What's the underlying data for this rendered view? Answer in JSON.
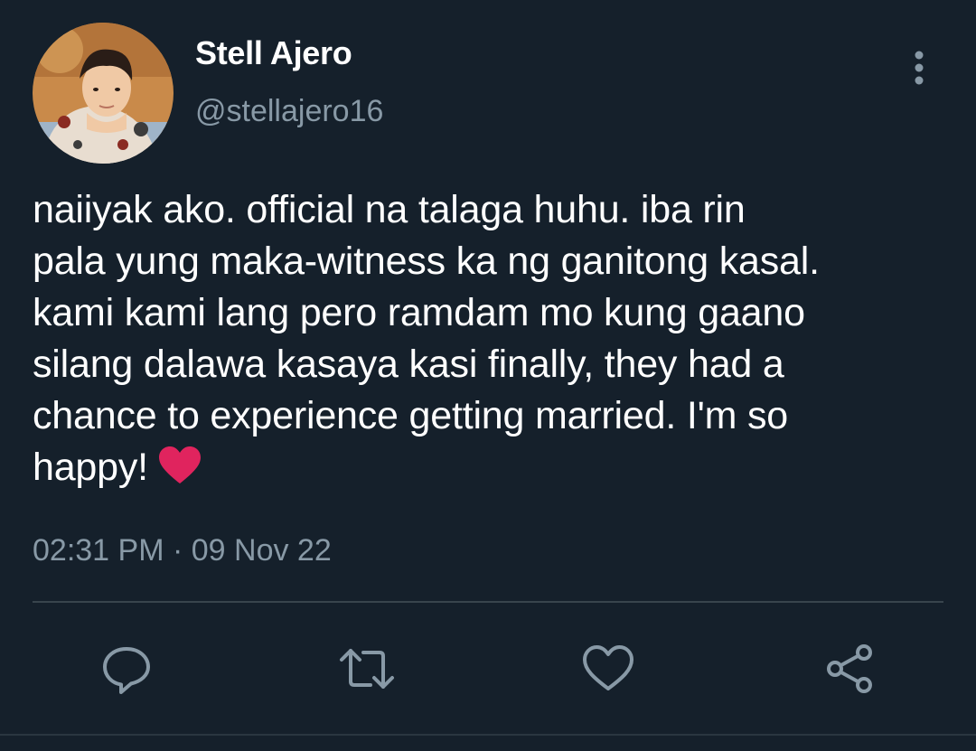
{
  "user": {
    "display_name": "Stell Ajero",
    "handle": "@stellajero16"
  },
  "tweet": {
    "lines": [
      "naiiyak ako. official na talaga huhu. iba rin",
      "pala yung maka-witness ka ng ganitong kasal.",
      "kami kami lang pero ramdam mo kung gaano",
      "silang dalawa kasaya kasi finally, they had a",
      "chance to experience getting married. I'm so",
      "happy!"
    ],
    "emoji": "red-heart",
    "timestamp": "02:31 PM · 09 Nov 22"
  },
  "actions": [
    {
      "icon": "reply-icon"
    },
    {
      "icon": "retweet-icon"
    },
    {
      "icon": "like-icon"
    },
    {
      "icon": "share-icon"
    }
  ],
  "colors": {
    "background": "#15202b",
    "text": "#ffffff",
    "muted": "#8899a6",
    "divider": "#38444d",
    "heart": "#e0245e"
  }
}
